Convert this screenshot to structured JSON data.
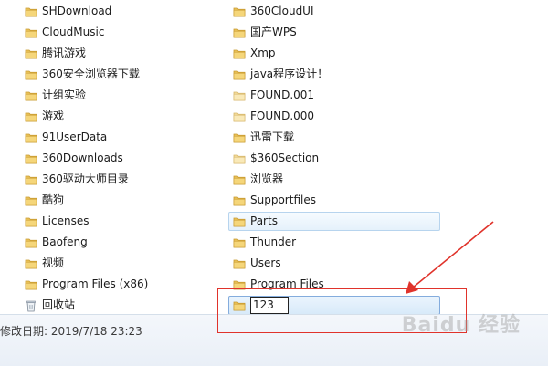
{
  "colors": {
    "folder": "#e9c25a",
    "folder_dark": "#c99a2f",
    "annotation": "#e0332b"
  },
  "left_column": [
    {
      "label": "SHDownload",
      "icon": "folder-icon"
    },
    {
      "label": "CloudMusic",
      "icon": "folder-icon"
    },
    {
      "label": "腾讯游戏",
      "icon": "folder-icon"
    },
    {
      "label": "360安全浏览器下载",
      "icon": "folder-icon"
    },
    {
      "label": "计组实验",
      "icon": "folder-icon"
    },
    {
      "label": "游戏",
      "icon": "folder-icon"
    },
    {
      "label": "91UserData",
      "icon": "folder-icon"
    },
    {
      "label": "360Downloads",
      "icon": "folder-icon"
    },
    {
      "label": "360驱动大师目录",
      "icon": "folder-icon"
    },
    {
      "label": "酷狗",
      "icon": "folder-icon"
    },
    {
      "label": "Licenses",
      "icon": "folder-icon"
    },
    {
      "label": "Baofeng",
      "icon": "folder-icon"
    },
    {
      "label": "视频",
      "icon": "folder-icon"
    },
    {
      "label": "Program Files (x86)",
      "icon": "folder-icon"
    },
    {
      "label": "回收站",
      "icon": "recycle-bin-icon"
    }
  ],
  "right_column": [
    {
      "label": "360CloudUI",
      "icon": "folder-icon"
    },
    {
      "label": "国产WPS",
      "icon": "folder-icon"
    },
    {
      "label": "Xmp",
      "icon": "folder-icon"
    },
    {
      "label": "java程序设计！",
      "icon": "folder-icon"
    },
    {
      "label": "FOUND.001",
      "icon": "folder-icon"
    },
    {
      "label": "FOUND.000",
      "icon": "folder-icon"
    },
    {
      "label": "迅雷下载",
      "icon": "folder-icon"
    },
    {
      "label": "$360Section",
      "icon": "folder-icon"
    },
    {
      "label": "浏览器",
      "icon": "folder-icon"
    },
    {
      "label": "Supportfiles",
      "icon": "folder-icon"
    },
    {
      "label": "Parts",
      "icon": "folder-icon"
    },
    {
      "label": "Thunder",
      "icon": "folder-icon"
    },
    {
      "label": "Users",
      "icon": "folder-icon"
    },
    {
      "label": "Program Files",
      "icon": "folder-icon"
    }
  ],
  "rename": {
    "value": "123",
    "icon": "folder-icon"
  },
  "status_bar": {
    "modified": "修改日期: 2019/7/18 23:23"
  },
  "watermark": "Baidu 经验"
}
